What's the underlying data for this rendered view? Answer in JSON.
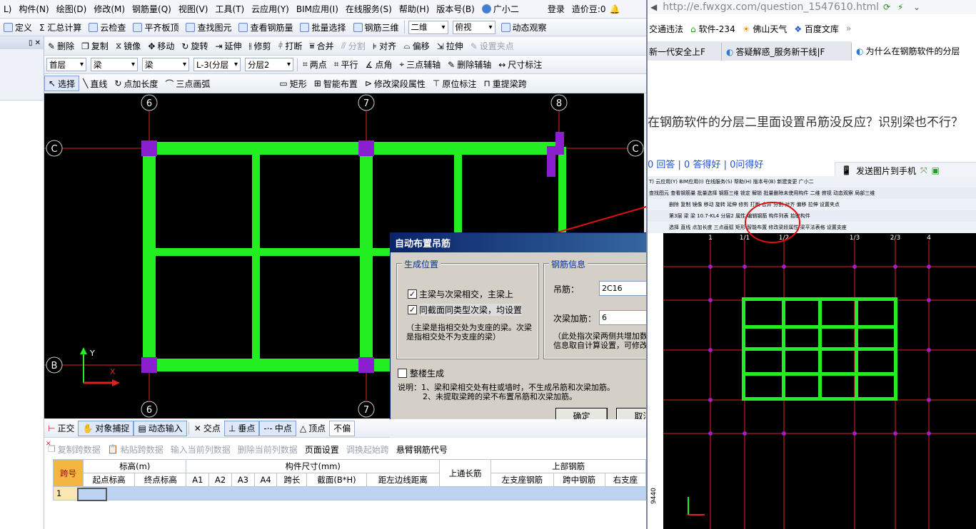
{
  "menu": [
    "L)",
    "构件(N)",
    "绘图(D)",
    "修改(M)",
    "钢筋量(Q)",
    "视图(V)",
    "工具(T)",
    "云应用(Y)",
    "BIM应用(I)",
    "在线服务(S)",
    "帮助(H)",
    "版本号(B)",
    "广小二",
    "登录",
    "造价豆:0"
  ],
  "tb1": [
    "定义",
    "Σ 汇总计算",
    "云检查",
    "平齐板顶",
    "查找图元",
    "查看钢筋量",
    "批量选择",
    "钢筋三维",
    "二维",
    "俯视",
    "动态观察"
  ],
  "tb2": [
    "删除",
    "复制",
    "镜像",
    "移动",
    "旋转",
    "延伸",
    "修剪",
    "打断",
    "合并",
    "分割",
    "对齐",
    "偏移",
    "拉伸",
    "设置夹点"
  ],
  "tb3_dropdowns": [
    "首层",
    "梁",
    "梁",
    "L-3(分层",
    "分层2"
  ],
  "tb3": [
    "两点",
    "平行",
    "点角",
    "三点辅轴",
    "删除辅轴",
    "尺寸标注"
  ],
  "tb4": [
    "选择",
    "直线",
    "点加长度",
    "三点画弧",
    "矩形",
    "智能布置",
    "修改梁段属性",
    "原位标注",
    "重提梁跨"
  ],
  "panel_controls": "▯ ✕",
  "axis": {
    "top": [
      "6",
      "7",
      "8"
    ],
    "bottom": [
      "6",
      "7"
    ],
    "left": [
      "C",
      "B"
    ],
    "right": [
      "C"
    ]
  },
  "dialog": {
    "title": "自动布置吊筋",
    "close": "✕",
    "group1": "生成位置",
    "cb1": "主梁与次梁相交，主梁上",
    "cb2": "同截面同类型次梁，均设置",
    "note1": "（主梁是指相交处为支座的梁。次梁是指相交处不为支座的梁）",
    "group2": "钢筋信息",
    "rebar_label": "吊筋：",
    "rebar_value": "2C16",
    "secondary_label": "次梁加筋：",
    "secondary_value": "6",
    "note2": "（此处指次梁两侧共增加数量，信息取自计算设置，可修改）",
    "whole_floor": "整楼生成",
    "explain1": "说明：1、梁和梁相交处有柱或墙时，不生成吊筋和次梁加筋。",
    "explain2": "2、未提取梁跨的梁不布置吊筋和次梁加筋。",
    "ok": "确定",
    "cancel": "取消"
  },
  "snapbar": [
    "正交",
    "对象捕捉",
    "动态输入",
    "交点",
    "垂点",
    "中点",
    "顶点",
    "不偏"
  ],
  "bottom_toolbar": [
    "复制跨数据",
    "粘贴跨数据",
    "输入当前列数据",
    "删除当前列数据",
    "页面设置",
    "调换起始跨",
    "悬臂钢筋代号"
  ],
  "table": {
    "h1": [
      "跨号",
      "标高(m)",
      "构件尺寸(mm)",
      "上通长筋",
      "上部钢筋"
    ],
    "h2": [
      "起点标高",
      "终点标高",
      "A1",
      "A2",
      "A3",
      "A4",
      "跨长",
      "截面(B*H)",
      "距左边线距离",
      "左支座钢筋",
      "跨中钢筋",
      "右支座"
    ],
    "row1": "1"
  },
  "browser": {
    "url": "http://e.fwxgx.com/question_1547610.html",
    "bookmarks": [
      "交通违法",
      "软件-234",
      "佛山天气",
      "百度文库"
    ],
    "tabs": [
      "新一代安全上F",
      "答疑解惑_服务新干线|F",
      "为什么在钢筋软件的分层"
    ],
    "question": "在钢筋软件的分层二里面设置吊筋没反应？识别梁也不行？",
    "stats": "0 回答 | 0 答得好 | 0问得好",
    "send_photo": "发送图片到手机",
    "mini_axis": [
      "1",
      "1/1",
      "1/2",
      "1/3",
      "2/3",
      "4"
    ],
    "mini_dim": "9440",
    "mini_menu": "T) 云应用(Y) BIM应用(I) 在线服务(S) 帮助(H) 版本号(B) 新建变更 广小二",
    "mini_tb1": "查找图元 查看钢筋量 批量选择 钢筋三维 锁定 解锁 批量删除未使用构件 二维 俯视 动态观察 局部三维",
    "mini_tb2": "删除 复制 镜像 移动 旋转 延伸 修剪 打断 合并 分割 对齐 偏移 拉伸 设置夹点",
    "mini_tb3": "第3层 梁 梁 10.7-KL4 分层2 属性 编辑钢筋 构件列表 拾取构件",
    "mini_tb4": "选择 直线 点加长度 三点画弧 矩形 智能布置 修改梁段属性 梁平法表格 设置支座"
  },
  "colors": {
    "beam": "#22ee22",
    "column": "#8a1fd0",
    "axis": "#e02020",
    "annotation": "#e01010"
  }
}
